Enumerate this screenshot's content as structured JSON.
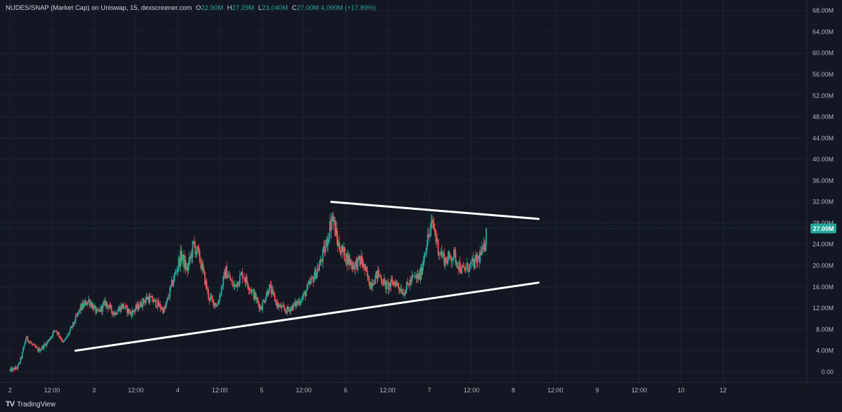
{
  "legend": {
    "symbol": "NUDES/SNAP (Market Cap) on Uniswap, 15, dexscreener.com",
    "o_label": "O",
    "o": "22.90M",
    "h_label": "H",
    "h": "27.29M",
    "l_label": "L",
    "l": "23.040M",
    "c_label": "C",
    "c": "27.00M",
    "change": "4.090M (+17.89%)"
  },
  "brand": {
    "name": "TradingView",
    "logo": "TV"
  },
  "colors": {
    "up": "#26a69a",
    "down": "#ef5350",
    "background": "#131722",
    "grid": "#1e222d",
    "text": "#b2b5be",
    "lines": "#ffffff"
  },
  "chart_data": {
    "type": "candlestick",
    "y_unit": "M",
    "ylim": [
      -2,
      70
    ],
    "xlim": [
      1.88,
      11.5
    ],
    "y_ticks": [
      "0.00",
      "4.00M",
      "8.00M",
      "12.00M",
      "16.00M",
      "20.00M",
      "24.00M",
      "28.00M",
      "32.00M",
      "36.00M",
      "40.00M",
      "44.00M",
      "48.00M",
      "52.00M",
      "56.00M",
      "60.00M",
      "64.00M",
      "68.00M"
    ],
    "y_tick_values": [
      0,
      4,
      8,
      12,
      16,
      20,
      24,
      28,
      32,
      36,
      40,
      44,
      48,
      52,
      56,
      60,
      64,
      68
    ],
    "x_ticks": [
      "2",
      "12:00",
      "3",
      "12:00",
      "4",
      "12:00",
      "5",
      "12:00",
      "6",
      "12:00",
      "7",
      "12:00",
      "8",
      "12:00",
      "9",
      "12:00",
      "10",
      "12"
    ],
    "x_tick_values": [
      2,
      2.5,
      3,
      3.5,
      4,
      4.5,
      5,
      5.5,
      6,
      6.5,
      7,
      7.5,
      8,
      8.5,
      9,
      9.5,
      10,
      10.5
    ],
    "last_price": 27.0,
    "last_price_label": "27.00M",
    "path_points": [
      {
        "x": 2.0,
        "y": 0.2
      },
      {
        "x": 2.1,
        "y": 0.8
      },
      {
        "x": 2.15,
        "y": 3.0
      },
      {
        "x": 2.2,
        "y": 6.5
      },
      {
        "x": 2.28,
        "y": 5.0
      },
      {
        "x": 2.35,
        "y": 4.0
      },
      {
        "x": 2.45,
        "y": 5.5
      },
      {
        "x": 2.55,
        "y": 8.0
      },
      {
        "x": 2.65,
        "y": 5.5
      },
      {
        "x": 2.75,
        "y": 8.5
      },
      {
        "x": 2.85,
        "y": 12.0
      },
      {
        "x": 2.95,
        "y": 13.5
      },
      {
        "x": 3.05,
        "y": 11.0
      },
      {
        "x": 3.15,
        "y": 13.0
      },
      {
        "x": 3.25,
        "y": 11.0
      },
      {
        "x": 3.35,
        "y": 12.5
      },
      {
        "x": 3.45,
        "y": 11.0
      },
      {
        "x": 3.55,
        "y": 12.5
      },
      {
        "x": 3.65,
        "y": 14.0
      },
      {
        "x": 3.75,
        "y": 13.0
      },
      {
        "x": 3.85,
        "y": 11.5
      },
      {
        "x": 3.95,
        "y": 17.0
      },
      {
        "x": 4.05,
        "y": 22.0
      },
      {
        "x": 4.12,
        "y": 19.0
      },
      {
        "x": 4.2,
        "y": 24.0
      },
      {
        "x": 4.28,
        "y": 21.0
      },
      {
        "x": 4.38,
        "y": 14.0
      },
      {
        "x": 4.48,
        "y": 12.5
      },
      {
        "x": 4.58,
        "y": 19.0
      },
      {
        "x": 4.68,
        "y": 16.0
      },
      {
        "x": 4.78,
        "y": 18.5
      },
      {
        "x": 4.9,
        "y": 15.0
      },
      {
        "x": 5.0,
        "y": 12.0
      },
      {
        "x": 5.1,
        "y": 16.0
      },
      {
        "x": 5.2,
        "y": 12.5
      },
      {
        "x": 5.3,
        "y": 11.5
      },
      {
        "x": 5.4,
        "y": 12.5
      },
      {
        "x": 5.5,
        "y": 14.0
      },
      {
        "x": 5.6,
        "y": 17.0
      },
      {
        "x": 5.7,
        "y": 20.0
      },
      {
        "x": 5.78,
        "y": 24.0
      },
      {
        "x": 5.85,
        "y": 29.5
      },
      {
        "x": 5.92,
        "y": 24.0
      },
      {
        "x": 6.0,
        "y": 22.0
      },
      {
        "x": 6.1,
        "y": 20.0
      },
      {
        "x": 6.2,
        "y": 21.0
      },
      {
        "x": 6.3,
        "y": 16.5
      },
      {
        "x": 6.4,
        "y": 18.5
      },
      {
        "x": 6.5,
        "y": 16.0
      },
      {
        "x": 6.6,
        "y": 17.0
      },
      {
        "x": 6.7,
        "y": 15.0
      },
      {
        "x": 6.8,
        "y": 17.5
      },
      {
        "x": 6.9,
        "y": 18.0
      },
      {
        "x": 6.97,
        "y": 24.0
      },
      {
        "x": 7.05,
        "y": 28.0
      },
      {
        "x": 7.12,
        "y": 23.0
      },
      {
        "x": 7.2,
        "y": 21.0
      },
      {
        "x": 7.3,
        "y": 22.0
      },
      {
        "x": 7.4,
        "y": 19.0
      },
      {
        "x": 7.5,
        "y": 20.0
      },
      {
        "x": 7.55,
        "y": 20.5
      },
      {
        "x": 7.62,
        "y": 22.0
      },
      {
        "x": 7.66,
        "y": 23.0
      },
      {
        "x": 7.69,
        "y": 27.0
      }
    ],
    "trendlines": [
      {
        "name": "upper",
        "x": [
          5.83,
          8.3
        ],
        "y": [
          32.0,
          28.8
        ]
      },
      {
        "name": "lower",
        "x": [
          2.78,
          8.3
        ],
        "y": [
          4.0,
          16.8
        ]
      }
    ]
  }
}
